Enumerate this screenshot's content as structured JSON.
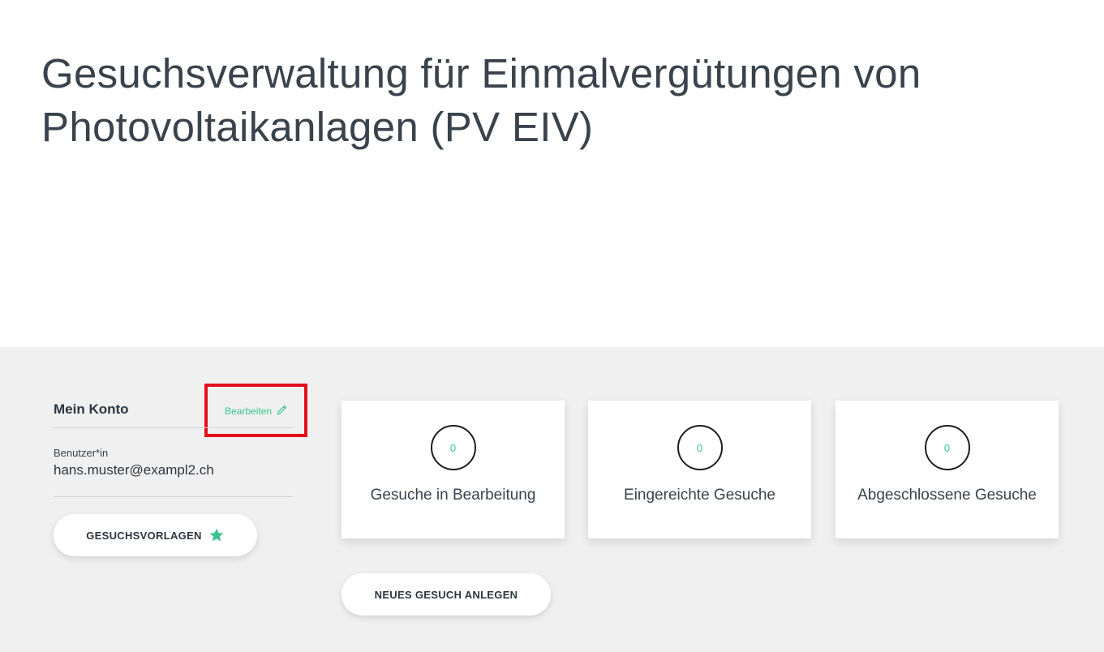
{
  "header": {
    "title": "Gesuchsverwaltung für Einmalvergütungen von Photovoltaikanlagen (PV EIV)"
  },
  "account": {
    "title": "Mein Konto",
    "edit_label": "Bearbeiten",
    "user_label": "Benutzer*in",
    "user_email": "hans.muster@exampl2.ch",
    "templates_button": "GESUCHSVORLAGEN"
  },
  "stats": [
    {
      "count": "0",
      "label": "Gesuche in Bearbeitung"
    },
    {
      "count": "0",
      "label": "Eingereichte Gesuche"
    },
    {
      "count": "0",
      "label": "Abgeschlossene Gesuche"
    }
  ],
  "actions": {
    "new_request_button": "NEUES GESUCH ANLEGEN"
  },
  "icons": {
    "edit": "pencil-icon",
    "templates": "star-icon"
  },
  "colors": {
    "accent": "#3cc48e",
    "highlight": "#e3101c",
    "dashboard_bg": "#f0f0f0",
    "text": "#2d3640"
  }
}
